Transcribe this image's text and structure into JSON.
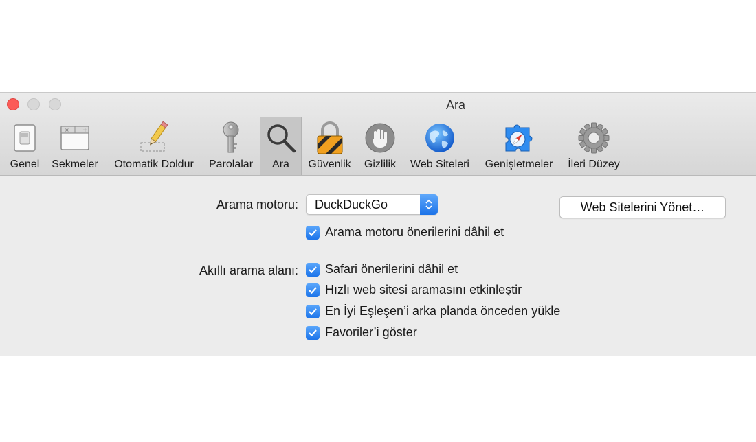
{
  "window": {
    "title": "Ara"
  },
  "toolbar": {
    "items": [
      {
        "label": "Genel",
        "icon": "switch-icon"
      },
      {
        "label": "Sekmeler",
        "icon": "tabs-icon"
      },
      {
        "label": "Otomatik Doldur",
        "icon": "pencil-icon"
      },
      {
        "label": "Parolalar",
        "icon": "key-icon"
      },
      {
        "label": "Ara",
        "icon": "magnifier-icon",
        "selected": true
      },
      {
        "label": "Güvenlik",
        "icon": "lock-icon"
      },
      {
        "label": "Gizlilik",
        "icon": "hand-icon"
      },
      {
        "label": "Web Siteleri",
        "icon": "globe-icon"
      },
      {
        "label": "Genişletmeler",
        "icon": "puzzle-compass-icon"
      },
      {
        "label": "İleri Düzey",
        "icon": "gear-icon"
      }
    ]
  },
  "search": {
    "engine_label": "Arama motoru:",
    "engine_value": "DuckDuckGo",
    "include_engine_suggestions": "Arama motoru önerilerini dâhil et",
    "smart_field_label": "Akıllı arama alanı:",
    "include_safari_suggestions": "Safari önerilerini dâhil et",
    "quick_website_search": "Hızlı web sitesi aramasını etkinleştir",
    "manage_websites_button": "Web Sitelerini Yönet…",
    "preload_top_hit": "En İyi Eşleşen’i arka planda önceden yükle",
    "show_favorites": "Favoriler’i göster"
  },
  "colors": {
    "accent": "#1c74ea",
    "close": "#fc5b57"
  }
}
